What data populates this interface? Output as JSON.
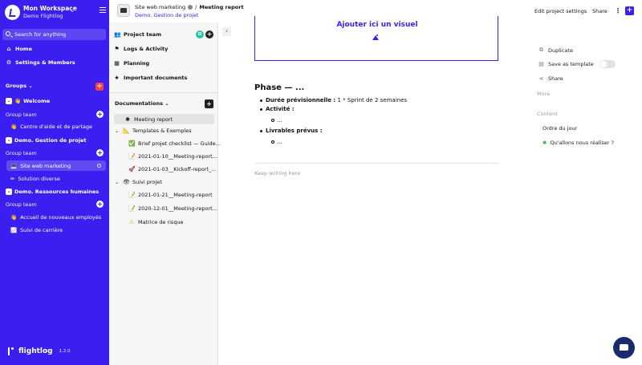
{
  "workspace": {
    "name": "Mon Workspace",
    "subtitle": "Demo Flightlog"
  },
  "search": {
    "label": "Search for anything"
  },
  "nav": {
    "home": "Home",
    "settings": "Settings & Members"
  },
  "groups": {
    "label": "Groups",
    "list": [
      {
        "name": "Welcome",
        "team_label": "Group team",
        "items": [
          {
            "label": "Centre d'aide et de partage"
          }
        ]
      },
      {
        "name": "Demo. Gestion de projet",
        "team_label": "Group team",
        "items": [
          {
            "label": "Site web marketing"
          },
          {
            "label": "Solution diverse"
          }
        ]
      },
      {
        "name": "Demo. Ressources humaines",
        "team_label": "Group team",
        "items": [
          {
            "label": "Accueil de nouveaux employés"
          },
          {
            "label": "Suivi de carrière"
          }
        ]
      }
    ]
  },
  "brand": {
    "name": "flightlog",
    "version": "1.2.0"
  },
  "project_panel": {
    "items": [
      "Project team",
      "Logs & Activity",
      "Planning",
      "Important documents"
    ],
    "avatar_initial": "D",
    "documentations_label": "Documentations"
  },
  "tree": [
    {
      "label": "Meeting report"
    },
    {
      "label": "Templates & Exemples"
    },
    {
      "label": "Brief projet checklist — Guide..."
    },
    {
      "label": "2021-01-10__Meeting-report..."
    },
    {
      "label": "2021-01-03__Kickoff-report_..."
    },
    {
      "label": "Suivi projet"
    },
    {
      "label": "2021-01-21__Meeting-report"
    },
    {
      "label": "2020-12-01__Meeting-report..."
    },
    {
      "label": "Matrice de risque"
    }
  ],
  "topbar": {
    "crumb_parent": "Site web marketing",
    "crumb_current": "Meeting report",
    "crumb_sub": "Demo. Gestion de projet",
    "edit_settings": "Edit project settings",
    "share": "Share"
  },
  "editor": {
    "cover_label": "Ajouter ici un visuel",
    "phase_title": "Phase — ...",
    "bullets": {
      "duree_label": "Durée prévisionnelle :",
      "duree_value": "1 * Sprint de 2 semaines",
      "activite_label": "Activité :",
      "activite_sub": "...",
      "livrables_label": "Livrables prévus :",
      "livrables_sub": "..."
    },
    "placeholder": "Keep writing here"
  },
  "right_panel": {
    "duplicate": "Duplicate",
    "save_template": "Save as template",
    "share": "Share",
    "more": "More",
    "content_label": "Content",
    "content_items": [
      "Ordre du jour",
      "Qu'allons nous réaliser ?"
    ]
  }
}
